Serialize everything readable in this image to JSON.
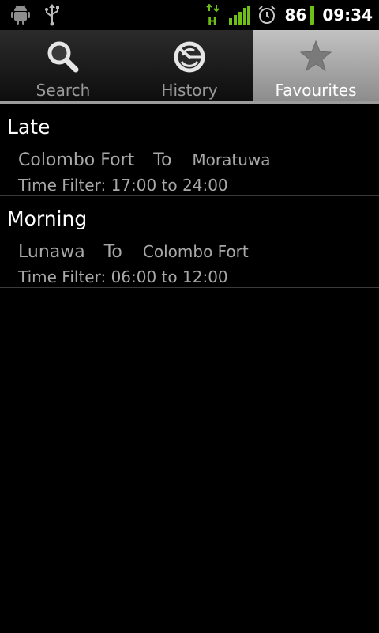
{
  "status_bar": {
    "icons": [
      "android-icon",
      "usb-icon",
      "hspa-icon",
      "signal-icon",
      "alarm-icon"
    ],
    "battery": "86",
    "time": "09:34",
    "colors": {
      "signal": "#6fc016",
      "hspa": "#6fc016"
    }
  },
  "tabs": [
    {
      "label": "Search",
      "icon": "search-icon",
      "active": false
    },
    {
      "label": "History",
      "icon": "history-icon",
      "active": false
    },
    {
      "label": "Favourites",
      "icon": "star-icon",
      "active": true
    }
  ],
  "favourites": [
    {
      "title": "Late",
      "from": "Colombo Fort",
      "to_label": "To",
      "to": "Moratuwa",
      "filter": "Time Filter: 17:00 to 24:00"
    },
    {
      "title": "Morning",
      "from": "Lunawa",
      "to_label": "To",
      "to": "Colombo Fort",
      "filter": "Time Filter: 06:00 to 12:00"
    }
  ]
}
